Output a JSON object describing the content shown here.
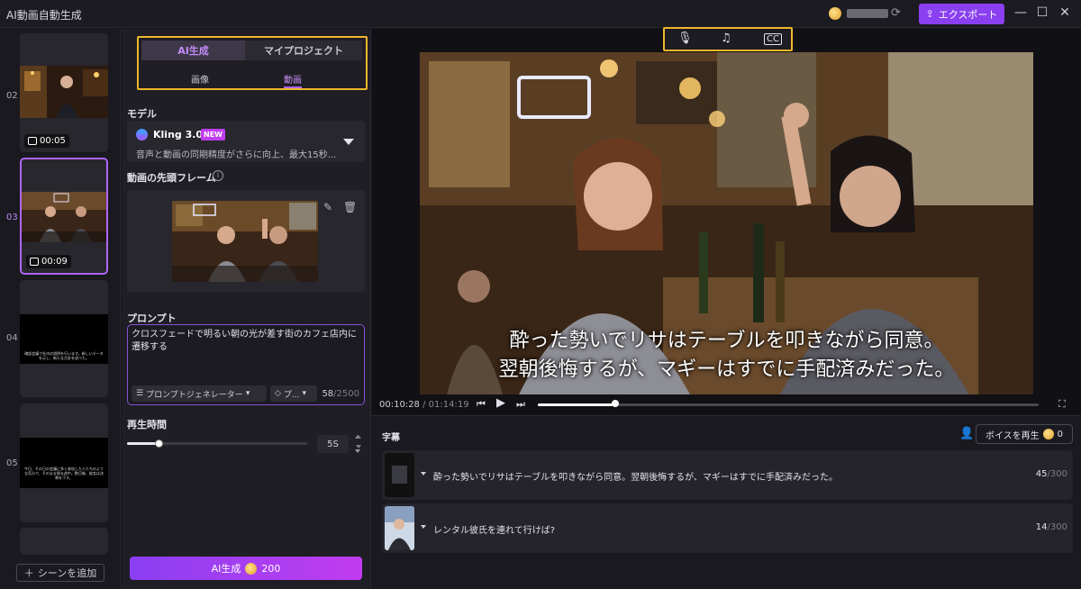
{
  "app": {
    "title": "AI動画自動生成",
    "export_label": "エクスポート"
  },
  "scenes": [
    {
      "num": "02",
      "duration": "00:05",
      "kind": "image"
    },
    {
      "num": "03",
      "duration": "00:09",
      "kind": "video",
      "active": true
    },
    {
      "num": "04",
      "caption": "確認会議で社内の説明を行います。新しいデータを示し、新たな方針を述べた。"
    },
    {
      "num": "05",
      "caption": "今日、その日の会議に多く参加した人たちのような気分で、そのまま帰る途中。数日後、彼女は決断を下す。"
    }
  ],
  "add_scene_label": "シーンを追加",
  "mode": {
    "tab_ai": "AI生成",
    "tab_projects": "マイプロジェクト",
    "sub_image": "画像",
    "sub_video": "動画"
  },
  "model": {
    "label": "モデル",
    "name": "Kling 3.0",
    "badge": "NEW",
    "desc": "音声と動画の同期精度がさらに向上、最大15秒..."
  },
  "first_frame_label": "動画の先頭フレーム",
  "prompt": {
    "label": "プロンプト",
    "text": "クロスフェードで明るい朝の光が差す街のカフェ店内に遷移する",
    "generator_label": "プロンプトジェネレーター",
    "style_label": "プ...",
    "count": "58",
    "max": "/2500"
  },
  "duration": {
    "label": "再生時間",
    "value": "5S",
    "level": 0.18
  },
  "generate": {
    "label": "AI生成",
    "cost": "200"
  },
  "player": {
    "subtitle_line1": "酔った勢いでリサはテーブルを叩きながら同意。",
    "subtitle_line2": "翌朝後悔するが、マギーはすでに手配済みだった。",
    "current_time": "00:10:28",
    "total_time": "/ 01:14:19",
    "progress": 0.15
  },
  "captions_panel": {
    "title": "字幕",
    "voice_btn": "ボイスを再生",
    "voice_cost": "0",
    "rows": [
      {
        "text": "酔った勢いでリサはテーブルを叩きながら同意。翌朝後悔するが、マギーはすでに手配済みだった。",
        "count": "45",
        "max": "/300"
      },
      {
        "text": "レンタル彼氏を連れて行けば?",
        "count": "14",
        "max": "/300"
      }
    ]
  }
}
